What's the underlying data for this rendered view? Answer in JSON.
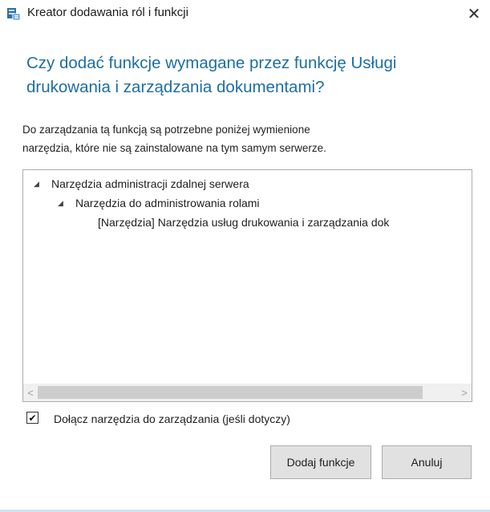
{
  "window": {
    "title": "Kreator dodawania ról i funkcji",
    "close_glyph": "✕",
    "icon": "server-manager-icon"
  },
  "dialog": {
    "heading_line1": "Czy dodać funkcje wymagane przez funkcję Usługi",
    "heading_line2": "drukowania i zarządzania dokumentami?",
    "description_line1": "Do zarządzania tą funkcją są potrzebne poniżej wymienione",
    "description_line2": "narzędzia, które nie są zainstalowane na tym samym serwerze."
  },
  "tree": {
    "items": [
      {
        "label": "Narzędzia administracji zdalnej serwera",
        "expanded": true,
        "level": 0
      },
      {
        "label": "Narzędzia do administrowania rolami",
        "expanded": true,
        "level": 1
      },
      {
        "label": "[Narzędzia] Narzędzia usług drukowania i zarządzania dok",
        "expanded": false,
        "level": 2
      }
    ],
    "scroll_left_glyph": "<",
    "scroll_right_glyph": ">"
  },
  "options": {
    "include_tools_label": "Dołącz narzędzia do zarządzania (jeśli dotyczy)",
    "include_tools_checked": true,
    "check_glyph": "✔"
  },
  "buttons": {
    "add_features": "Dodaj funkcje",
    "cancel": "Anuluj"
  },
  "colors": {
    "heading": "#1c6ea4"
  }
}
